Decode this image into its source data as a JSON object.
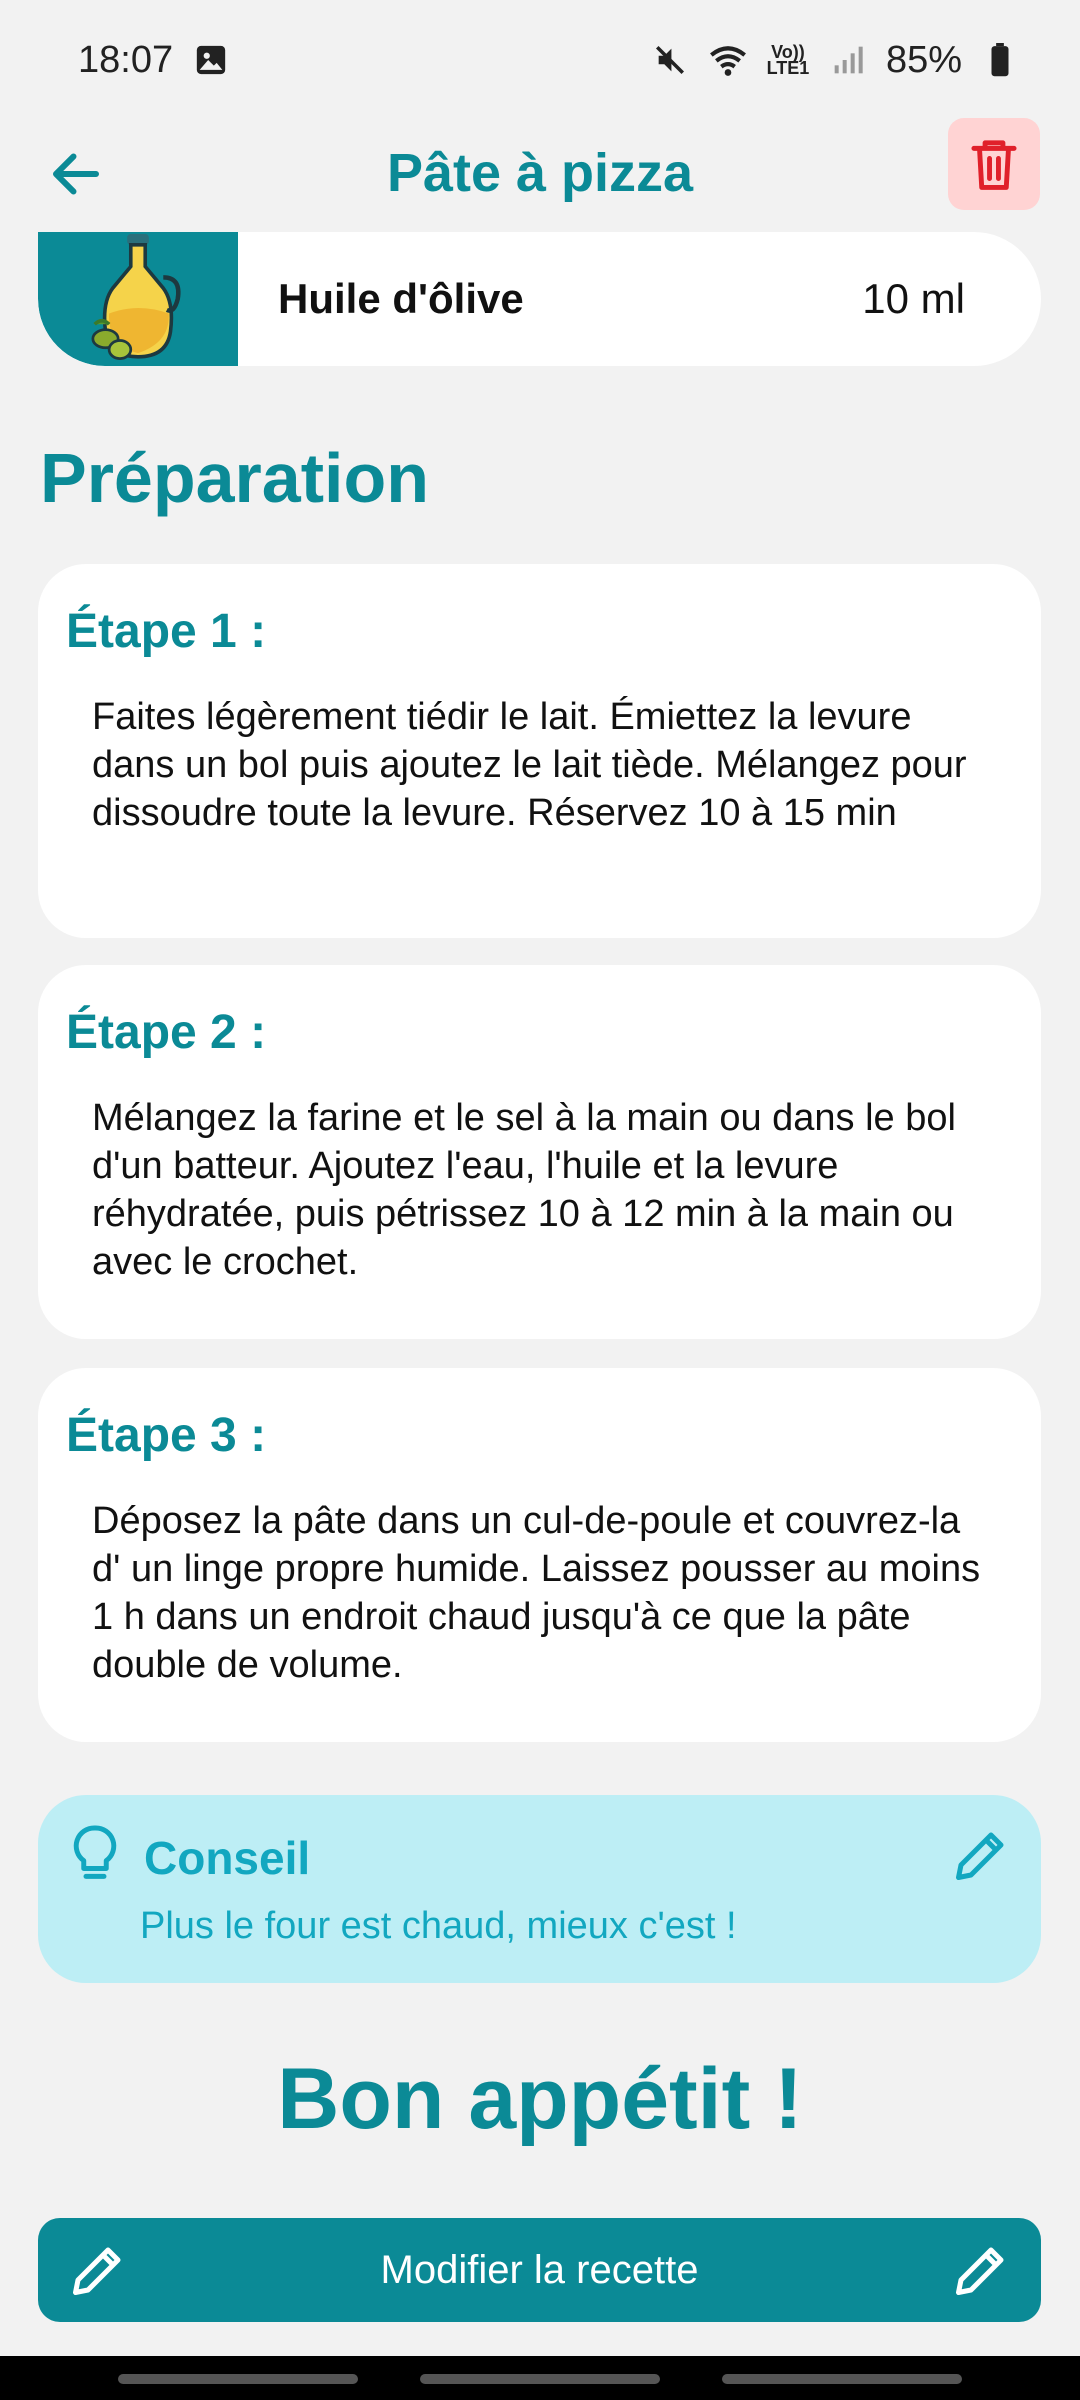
{
  "status_bar": {
    "time": "18:07",
    "network_label": "Vo)) LTE1",
    "battery": "85%",
    "icons": [
      "image-icon",
      "mute-icon",
      "wifi-icon",
      "signal-icon",
      "battery-icon"
    ]
  },
  "app_bar": {
    "title": "Pâte à pizza",
    "back_icon": "arrow-left-icon",
    "delete_icon": "trash-icon"
  },
  "ingredient": {
    "name": "Huile d'ôlive",
    "quantity": "10 ml",
    "image_icon": "olive-oil-bottle-icon"
  },
  "preparation": {
    "title": "Préparation",
    "steps": [
      {
        "label": "Étape 1 :",
        "text": "Faites légèrement tiédir le lait. Émiettez la levure dans un bol puis ajoutez le lait tiède. Mélangez pour dissoudre toute la levure. Réservez 10 à 15 min"
      },
      {
        "label": "Étape 2 :",
        "text": "Mélangez la farine et le sel à la main ou dans le bol d'un batteur. Ajoutez l'eau, l'huile et la levure réhydratée, puis pétrissez 10 à 12 min à la main ou avec le crochet."
      },
      {
        "label": "Étape 3 :",
        "text": "Déposez la pâte dans un cul-de-poule et couvrez-la d' un linge propre humide. Laissez pousser au moins 1 h dans un endroit chaud jusqu'à ce que la pâte double de volume."
      }
    ]
  },
  "tip": {
    "title": "Conseil",
    "text": "Plus le four est chaud, mieux c'est !"
  },
  "closing": "Bon appétit !",
  "edit_button": {
    "label": "Modifier la recette"
  },
  "colors": {
    "primary": "#0b8a96",
    "tip_bg": "#bdeef5",
    "tip_text": "#12a7c0",
    "delete_bg": "#ffd3d3",
    "delete_icon": "#e0202a",
    "background": "#f2f2f2"
  }
}
